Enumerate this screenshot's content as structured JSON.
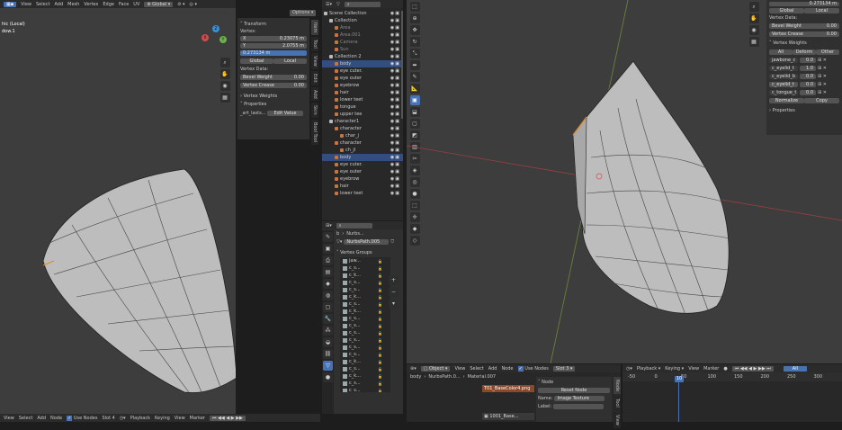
{
  "left_viewport": {
    "header_items": [
      "View",
      "Select",
      "Add",
      "Mesh",
      "Vertex",
      "Edge",
      "Face",
      "UV"
    ],
    "transform_orientation": "Global",
    "options_label": "Options",
    "overlay_title": "hic (Local)",
    "overlay_sub": "dow.1",
    "gizmo_axes": [
      "X",
      "Y",
      "Z"
    ]
  },
  "n_panel_left": {
    "tabs": [
      "Item",
      "Tool",
      "View",
      "Edit",
      "Add",
      "Skin",
      "Bool Tool"
    ],
    "transform_label": "Transform",
    "vertex_label": "Vertex:",
    "x_label": "X",
    "x_value": "0.23075 m",
    "y_label": "Y",
    "y_value": "2.0755 m",
    "z_value": "0.273134 m",
    "global_label": "Global",
    "local_label": "Local",
    "vertex_data_label": "Vertex Data:",
    "bevel_weight_label": "Bevel Weight",
    "bevel_weight_value": "0.00",
    "vertex_crease_label": "Vertex Crease",
    "vertex_crease_value": "0.00",
    "vertex_weights_label": "Vertex Weights",
    "properties_label": "Properties",
    "prop_name": "_art_lasts...",
    "edit_value_label": "Edit Value"
  },
  "outliner": {
    "items": [
      {
        "label": "Scene Collection",
        "depth": 0
      },
      {
        "label": "Collection",
        "depth": 1
      },
      {
        "label": "Area",
        "depth": 2,
        "dim": true
      },
      {
        "label": "Area.001",
        "depth": 2,
        "dim": true
      },
      {
        "label": "Camera",
        "depth": 2,
        "dim": true
      },
      {
        "label": "Sun",
        "depth": 2,
        "dim": true
      },
      {
        "label": "Collection 2",
        "depth": 1
      },
      {
        "label": "body",
        "depth": 2,
        "selected": true
      },
      {
        "label": "eye cuter.",
        "depth": 2
      },
      {
        "label": "eye outer",
        "depth": 2
      },
      {
        "label": "eyebrow",
        "depth": 2
      },
      {
        "label": "hair",
        "depth": 2
      },
      {
        "label": "lower teet",
        "depth": 2
      },
      {
        "label": "tongue",
        "depth": 2
      },
      {
        "label": "upper tee",
        "depth": 2
      },
      {
        "label": "character1",
        "depth": 1
      },
      {
        "label": "character",
        "depth": 2
      },
      {
        "label": "char_j",
        "depth": 3
      },
      {
        "label": "character",
        "depth": 2
      },
      {
        "label": "ch_jl",
        "depth": 3
      },
      {
        "label": "body",
        "depth": 2,
        "selected": true
      },
      {
        "label": "eye cuter.",
        "depth": 2
      },
      {
        "label": "eye outer",
        "depth": 2
      },
      {
        "label": "eyebrow",
        "depth": 2
      },
      {
        "label": "hair",
        "depth": 2
      },
      {
        "label": "lower teet",
        "depth": 2
      }
    ]
  },
  "properties": {
    "breadcrumb": [
      "b",
      "Nurbs..."
    ],
    "mesh_name": "NurbsPath.005",
    "vertex_groups_label": "Vertex Groups",
    "groups": [
      "jaw...",
      "c_s...",
      "c_k...",
      "c_s...",
      "c_s...",
      "c_k...",
      "c_s...",
      "c_k...",
      "c_s...",
      "c_s...",
      "c_s...",
      "c_s...",
      "c_s...",
      "c_s...",
      "c_k...",
      "c_s...",
      "c_k...",
      "c_s...",
      "c_s...",
      "c_s..."
    ]
  },
  "right_viewport": {
    "panel": {
      "z_value": "0.273134 m",
      "global_label": "Global",
      "local_label": "Local",
      "vertex_data_label": "Vertex Data:",
      "bevel_weight_label": "Bevel Weight",
      "bevel_weight_value": "0.00",
      "vertex_crease_label": "Vertex Crease",
      "vertex_crease_value": "0.00",
      "vertex_weights_label": "Vertex Weights",
      "tabs": [
        "All",
        "Deform",
        "Other"
      ],
      "weights": [
        {
          "name": "jawbone_c",
          "value": "0.0"
        },
        {
          "name": "c_eyelid_t",
          "value": "1.0"
        },
        {
          "name": "c_eyelid_b",
          "value": "0.0"
        },
        {
          "name": "c_eyelid_t",
          "value": "0.0"
        },
        {
          "name": "c_tongue_t",
          "value": "0.0"
        }
      ],
      "normalize_label": "Normalize",
      "copy_label": "Copy",
      "properties_label": "Properties"
    }
  },
  "node_editor": {
    "header_items": [
      "Object",
      "View",
      "Select",
      "Add",
      "Node"
    ],
    "use_nodes_label": "Use Nodes",
    "slot_label": "Slot 3",
    "breadcrumb": [
      "body",
      "NurbsPath.0...",
      "Material.007"
    ],
    "node_title": "T01_BaseColor4.png",
    "image_label": "1001_Base...",
    "n_panel": {
      "node_label": "Node",
      "reset_label": "Reset Node",
      "name_label": "Name:",
      "name_value": "Image Texture",
      "label_label": "Label:"
    },
    "tabs": [
      "Node",
      "Tool",
      "View"
    ]
  },
  "timeline": {
    "header_items": [
      "Playback",
      "Keying",
      "View",
      "Marker"
    ],
    "all_label": "All",
    "current_frame": "10",
    "ticks": [
      "-50",
      "0",
      "50",
      "100",
      "150",
      "200",
      "250",
      "300"
    ]
  },
  "bottom_left": {
    "items": [
      "View",
      "Select",
      "Add",
      "Node"
    ],
    "use_nodes_label": "Use Nodes",
    "slot_label": "Slot 4",
    "timeline_items": [
      "Playback",
      "Keying",
      "View",
      "Marker"
    ]
  }
}
